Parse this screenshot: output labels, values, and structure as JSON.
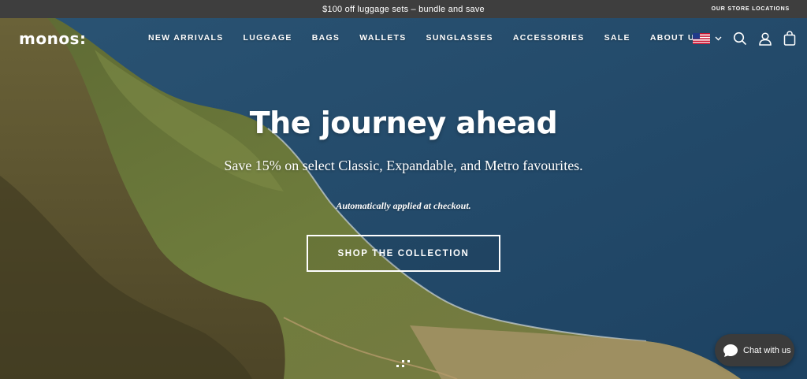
{
  "announcement": {
    "text": "$100 off luggage sets – bundle and save",
    "store_link": "OUR STORE LOCATIONS"
  },
  "nav": {
    "logo": "monos:",
    "items": [
      {
        "label": "NEW ARRIVALS"
      },
      {
        "label": "LUGGAGE"
      },
      {
        "label": "BAGS"
      },
      {
        "label": "WALLETS"
      },
      {
        "label": "SUNGLASSES"
      },
      {
        "label": "ACCESSORIES"
      },
      {
        "label": "SALE"
      },
      {
        "label": "ABOUT US"
      }
    ],
    "icons": [
      "us-flag-icon",
      "chevron-down-icon",
      "search-icon",
      "account-icon",
      "cart-bag-icon"
    ]
  },
  "hero": {
    "title": "The journey ahead",
    "subtitle": "Save 15% on select Classic, Expandable, and Metro favourites.",
    "note": "Automatically applied at checkout.",
    "cta": "SHOP THE COLLECTION"
  },
  "chat": {
    "label": "Chat with us"
  },
  "colors": {
    "announcement_bg": "#3e3e3e",
    "ocean": "#24496a",
    "cliff_green": "#6b7a3a",
    "chat_bg": "#3b3b3b"
  }
}
